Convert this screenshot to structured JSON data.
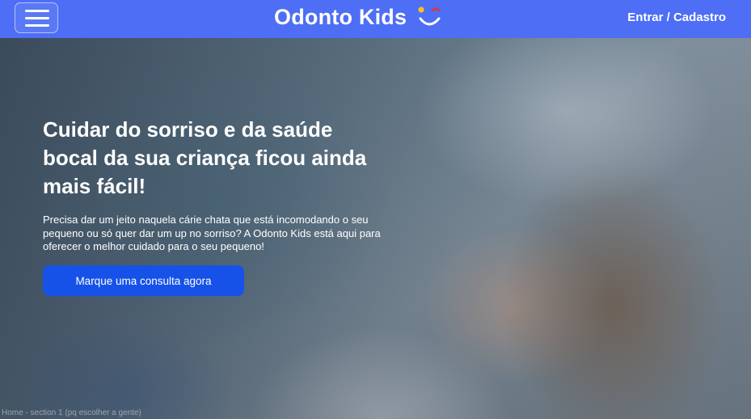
{
  "navbar": {
    "brand": "Odonto Kids",
    "auth_link": "Entrar / Cadastro",
    "menu_icon": "hamburger-menu-icon",
    "logo_icon": "smile-logo-icon",
    "background_color": "#4d6ef5"
  },
  "hero": {
    "title": "Cuidar do sorriso e da saúde bocal da sua criança ficou ainda mais fácil!",
    "description": "Precisa dar um jeito naquela cárie chata que está incomodando o seu pequeno ou só quer dar um up no sorriso? A Odonto Kids está aqui para oferecer o melhor cuidado para o  seu pequeno!",
    "cta_label": "Marque uma consulta agora",
    "cta_color": "#1652e8"
  },
  "frame_label": "Home - section 1 (pq escolher a gente)"
}
